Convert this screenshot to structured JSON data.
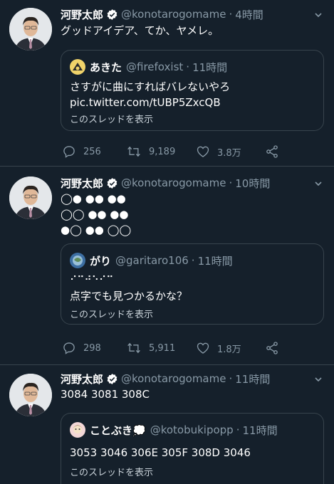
{
  "tweets": [
    {
      "author": "河野太郎",
      "handle": "@konotarogomame",
      "time": "4時間",
      "text": "グッドアイデア、てか、ヤメレ。",
      "quote": {
        "author": "あきた",
        "handle": "@firefoxist",
        "time": "11時間",
        "text": "さすがに曲にすればバレないやろ pic.twitter.com/tUBP5ZxcQB",
        "thread_label": "このスレッドを表示"
      },
      "replies": "256",
      "retweets": "9,189",
      "likes": "3.8万"
    },
    {
      "author": "河野太郎",
      "handle": "@konotarogomame",
      "time": "10時間",
      "braille_lines": [
        "◯● ●● ●●",
        "◯◯ ●● ●●",
        "●◯ ●● ◯◯"
      ],
      "quote": {
        "author": "がり",
        "handle": "@garitaro106",
        "time": "11時間",
        "braille": "⠊⠉⠚⠑⠊⠉",
        "text": "点字でも見つかるかな？",
        "thread_label": "このスレッドを表示"
      },
      "replies": "298",
      "retweets": "5,911",
      "likes": "1.8万"
    },
    {
      "author": "河野太郎",
      "handle": "@konotarogomame",
      "time": "11時間",
      "text": "3084 3081 308C",
      "quote": {
        "author": "ことぶき💭",
        "handle": "@kotobukipopp",
        "time": "11時間",
        "text": "3053 3046 306E 305F  308D 3046",
        "thread_label": "このスレッドを表示"
      }
    }
  ],
  "colors": {
    "background": "#15202b",
    "border": "#38444d",
    "muted": "#8899a6",
    "verified": "#ffffff"
  }
}
